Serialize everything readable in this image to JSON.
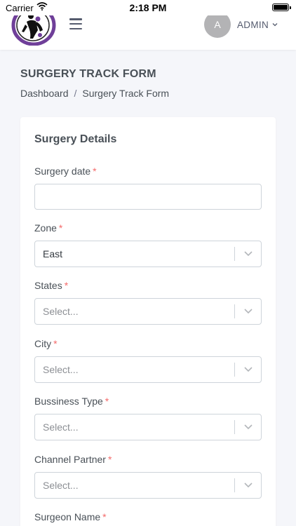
{
  "status_bar": {
    "carrier": "Carrier",
    "time": "2:18 PM"
  },
  "header": {
    "logo_icon": "orthopedic-logo-icon",
    "menu_icon": "hamburger-menu-icon",
    "user": {
      "avatar_letter": "A",
      "name": "ADMIN",
      "caret_icon": "chevron-down-icon"
    }
  },
  "page": {
    "title": "SURGERY TRACK FORM",
    "breadcrumb": {
      "home": "Dashboard",
      "separator": "/",
      "current": "Surgery Track Form"
    }
  },
  "form": {
    "section_title": "Surgery Details",
    "required_marker": "*",
    "surgery_date": {
      "label": "Surgery date",
      "value": ""
    },
    "zone": {
      "label": "Zone",
      "value": "East"
    },
    "states": {
      "label": "States",
      "placeholder": "Select..."
    },
    "city": {
      "label": "City",
      "placeholder": "Select..."
    },
    "business_type": {
      "label": "Bussiness Type",
      "placeholder": "Select..."
    },
    "channel_partner": {
      "label": "Channel Partner",
      "placeholder": "Select..."
    },
    "surgeon_name": {
      "label": "Surgeon Name"
    }
  },
  "colors": {
    "required": "#f46a6a",
    "border": "#ced4da",
    "page_bg": "#f5f6fa",
    "logo_purple": "#6f3f99"
  }
}
